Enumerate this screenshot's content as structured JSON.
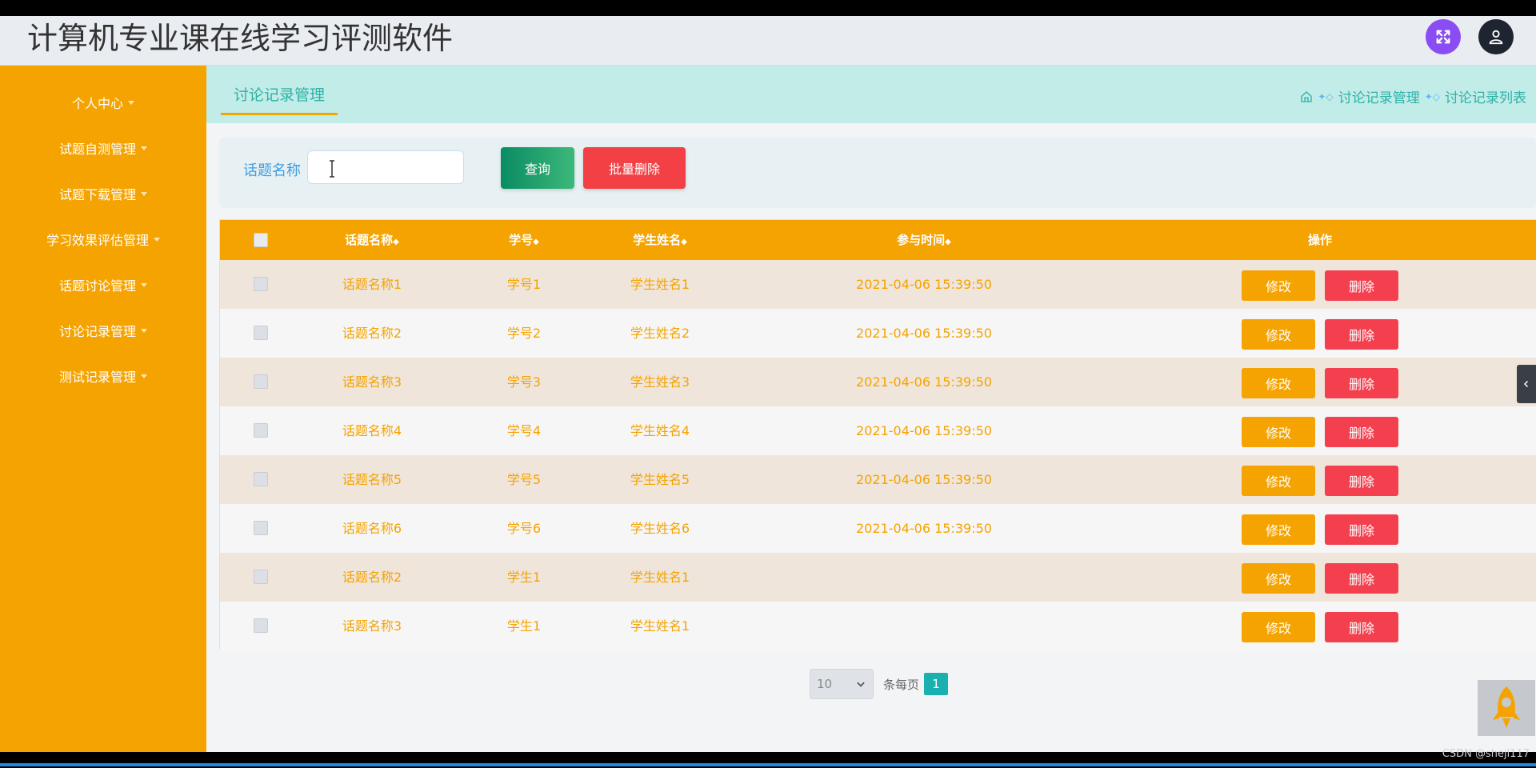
{
  "header": {
    "title": "计算机专业课在线学习评测软件"
  },
  "sidebar": {
    "items": [
      {
        "label": "个人中心"
      },
      {
        "label": "试题自测管理"
      },
      {
        "label": "试题下载管理"
      },
      {
        "label": "学习效果评估管理"
      },
      {
        "label": "话题讨论管理"
      },
      {
        "label": "讨论记录管理"
      },
      {
        "label": "测试记录管理"
      }
    ]
  },
  "crumbbar": {
    "tab": "讨论记录管理",
    "crumbs": [
      "讨论记录管理",
      "讨论记录列表"
    ]
  },
  "search": {
    "label": "话题名称",
    "value": "",
    "placeholder": "",
    "query_button": "查询",
    "batch_delete_button": "批量删除"
  },
  "table": {
    "columns": [
      "话题名称",
      "学号",
      "学生姓名",
      "参与时间",
      "操作"
    ],
    "sort_symbol": "◆",
    "rows": [
      {
        "topic": "话题名称1",
        "sno": "学号1",
        "name": "学生姓名1",
        "time": "2021-04-06 15:39:50"
      },
      {
        "topic": "话题名称2",
        "sno": "学号2",
        "name": "学生姓名2",
        "time": "2021-04-06 15:39:50"
      },
      {
        "topic": "话题名称3",
        "sno": "学号3",
        "name": "学生姓名3",
        "time": "2021-04-06 15:39:50"
      },
      {
        "topic": "话题名称4",
        "sno": "学号4",
        "name": "学生姓名4",
        "time": "2021-04-06 15:39:50"
      },
      {
        "topic": "话题名称5",
        "sno": "学号5",
        "name": "学生姓名5",
        "time": "2021-04-06 15:39:50"
      },
      {
        "topic": "话题名称6",
        "sno": "学号6",
        "name": "学生姓名6",
        "time": "2021-04-06 15:39:50"
      },
      {
        "topic": "话题名称2",
        "sno": "学生1",
        "name": "学生姓名1",
        "time": ""
      },
      {
        "topic": "话题名称3",
        "sno": "学生1",
        "name": "学生姓名1",
        "time": ""
      }
    ],
    "edit_label": "修改",
    "delete_label": "删除"
  },
  "pager": {
    "page_size": "10",
    "per_page_label": "条每页",
    "current_page": "1"
  },
  "watermark": "CSDN @shejl117",
  "colors": {
    "sidebar": "#f5a300",
    "accent": "#2fb1a6",
    "danger": "#f24044"
  }
}
